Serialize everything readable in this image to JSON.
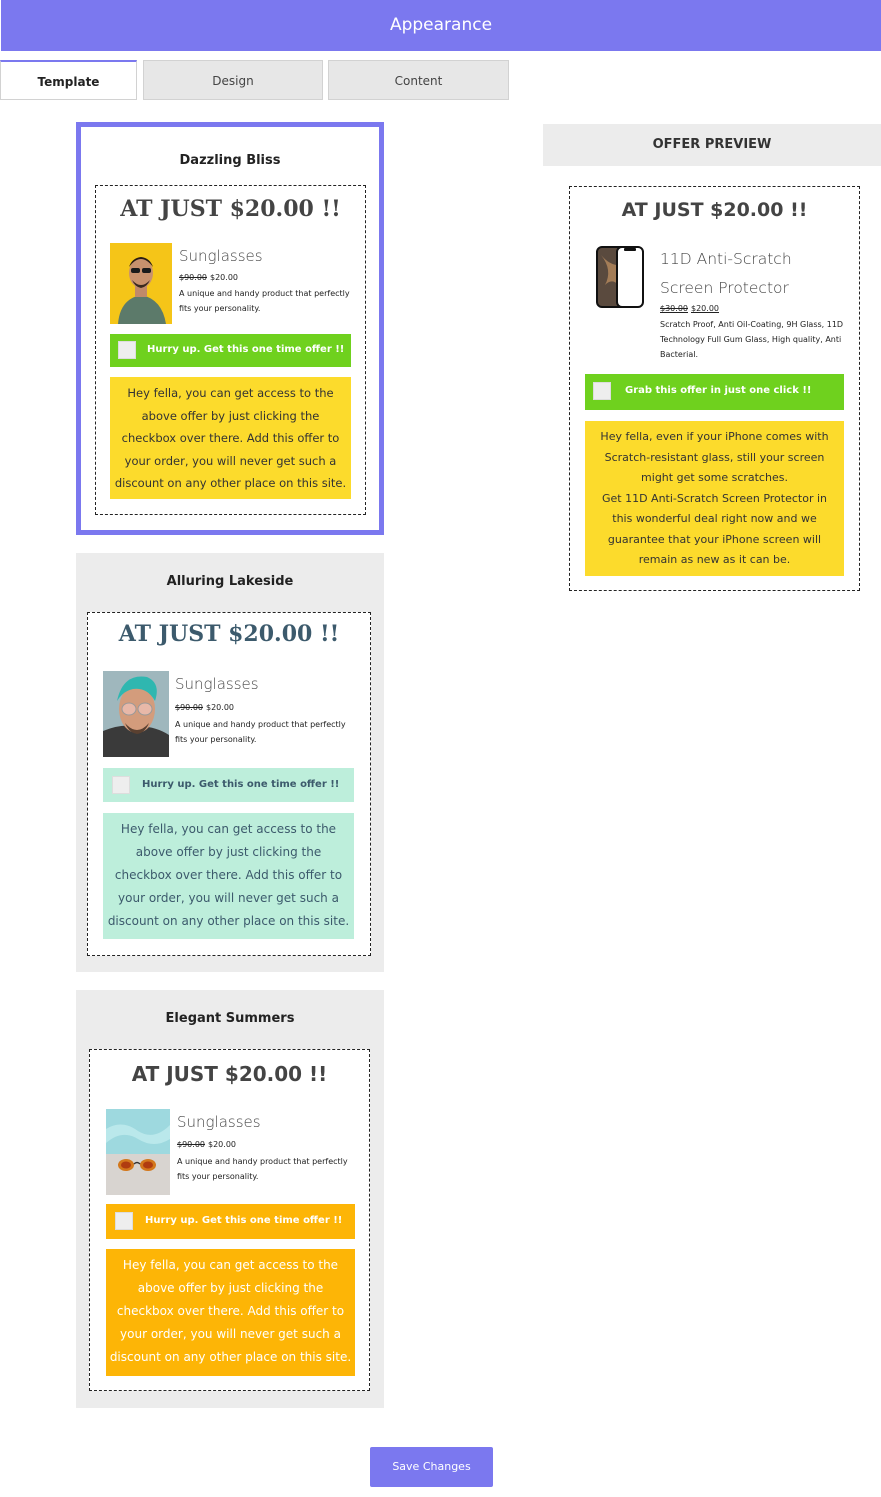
{
  "header": {
    "title": "Appearance"
  },
  "tabs": [
    {
      "label": "Template",
      "active": true
    },
    {
      "label": "Design",
      "active": false
    },
    {
      "label": "Content",
      "active": false
    }
  ],
  "templates": [
    {
      "name": "Dazzling Bliss",
      "selected": true,
      "title": "AT JUST $20.00 !!",
      "product_name": "Sunglasses",
      "old_price": "$90.00",
      "new_price": "$20.00",
      "description": "A unique and handy product that perfectly fits your personality.",
      "cta": "Hurry up. Get this one time offer !!",
      "message": "Hey fella, you can get access to the above offer by just clicking the checkbox over there. Add this offer to your order, you will never get such a discount on any other place on this site.",
      "colors": {
        "cta_bg": "#6fd11e",
        "cta_text": "#ffffff",
        "msg_bg": "#fcdb2c",
        "msg_text": "#333333",
        "title": "#444444"
      }
    },
    {
      "name": "Alluring Lakeside",
      "selected": false,
      "title": "AT JUST $20.00 !!",
      "product_name": "Sunglasses",
      "old_price": "$90.00",
      "new_price": "$20.00",
      "description": "A unique and handy product that perfectly fits your personality.",
      "cta": "Hurry up. Get this one time offer !!",
      "message": "Hey fella, you can get access to the above offer by just clicking the checkbox over there. Add this offer to your order, you will never get such a discount on any other place on this site.",
      "colors": {
        "cta_bg": "#bdeedb",
        "cta_text": "#3c5a6c",
        "msg_bg": "#bdeedb",
        "msg_text": "#3c5a6c",
        "title": "#3c5a6c"
      }
    },
    {
      "name": "Elegant Summers",
      "selected": false,
      "title": "AT JUST $20.00 !!",
      "product_name": "Sunglasses",
      "old_price": "$90.00",
      "new_price": "$20.00",
      "description": "A unique and handy product that perfectly fits your personality.",
      "cta": "Hurry up. Get this one time offer !!",
      "message": "Hey fella, you can get access to the above offer by just clicking the checkbox over there. Add this offer to your order, you will never get such a discount on any other place on this site.",
      "colors": {
        "cta_bg": "#fdb506",
        "cta_text": "#ffffff",
        "msg_bg": "#fdb506",
        "msg_text": "#ffffff",
        "title": "#444444"
      }
    }
  ],
  "preview": {
    "heading": "OFFER PREVIEW",
    "title": "AT JUST $20.00 !!",
    "product_name": "11D Anti-Scratch Screen Protector",
    "old_price": "$30.00",
    "new_price": "$20.00",
    "description": "Scratch Proof, Anti Oil-Coating, 9H Glass, 11D Technology Full Gum Glass, High quality, Anti Bacterial.",
    "cta": "Grab this offer in just one click !!",
    "message_line1": "Hey fella, even if your iPhone comes with Scratch-resistant glass, still your screen might get some scratches.",
    "message_line2": "Get 11D Anti-Scratch Screen Protector in this wonderful deal right now and we guarantee that your iPhone screen will remain as new as it can be.",
    "colors": {
      "cta_bg": "#6fd11e",
      "msg_bg": "#fcdb2c"
    }
  },
  "footer": {
    "save_label": "Save Changes"
  }
}
